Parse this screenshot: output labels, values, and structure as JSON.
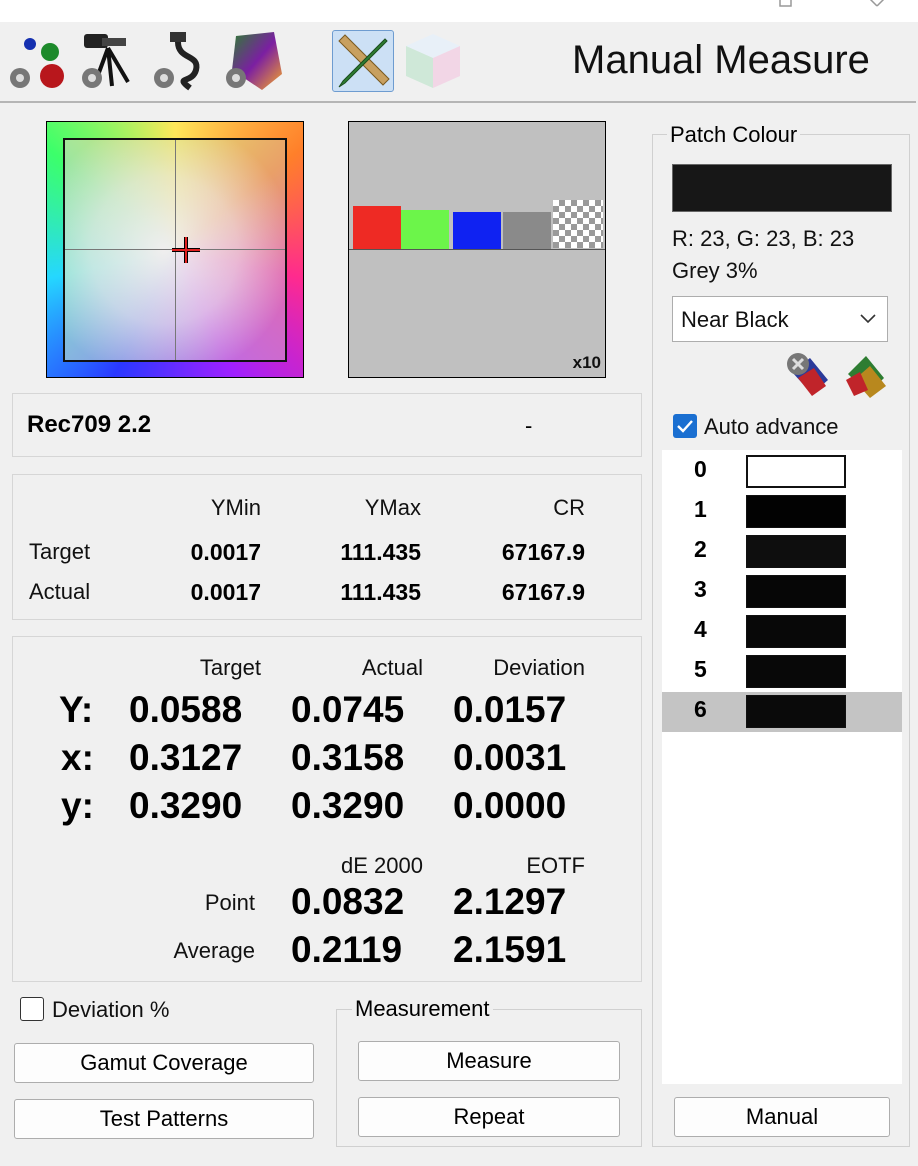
{
  "window": {
    "title": "Manual Measure"
  },
  "toolbar": {
    "icons": [
      {
        "name": "colour-dots-icon"
      },
      {
        "name": "tripod-meter-icon"
      },
      {
        "name": "cable-icon"
      },
      {
        "name": "colour-gamut-icon"
      },
      {
        "name": "pencil-ruler-icon"
      },
      {
        "name": "colour-cube-icon"
      }
    ]
  },
  "preview": {
    "zoom_label": "x10",
    "swatch_colors": [
      "#ee2a24",
      "#6cf54a",
      "#0f22f2",
      "#8a8a8a"
    ]
  },
  "profile": {
    "name": "Rec709 2.2",
    "status": "-"
  },
  "luminance": {
    "headers": [
      "YMin",
      "YMax",
      "CR"
    ],
    "rows": [
      {
        "label": "Target",
        "values": [
          "0.0017",
          "111.435",
          "67167.9"
        ]
      },
      {
        "label": "Actual",
        "values": [
          "0.0017",
          "111.435",
          "67167.9"
        ]
      }
    ]
  },
  "readings": {
    "headers": [
      "Target",
      "Actual",
      "Deviation"
    ],
    "rows": [
      {
        "label": "Y:",
        "values": [
          "0.0588",
          "0.0745",
          "0.0157"
        ]
      },
      {
        "label": "x:",
        "values": [
          "0.3127",
          "0.3158",
          "0.0031"
        ]
      },
      {
        "label": "y:",
        "values": [
          "0.3290",
          "0.3290",
          "0.0000"
        ]
      }
    ],
    "de_headers": [
      "dE 2000",
      "EOTF"
    ],
    "de_rows": [
      {
        "label": "Point",
        "values": [
          "0.0832",
          "2.1297"
        ]
      },
      {
        "label": "Average",
        "values": [
          "0.2119",
          "2.1591"
        ]
      }
    ]
  },
  "options": {
    "deviation_percent_label": "Deviation %",
    "deviation_percent_checked": false,
    "gamut_coverage_label": "Gamut Coverage",
    "test_patterns_label": "Test Patterns"
  },
  "measurement": {
    "group_title": "Measurement",
    "measure_label": "Measure",
    "repeat_label": "Repeat"
  },
  "patch": {
    "group_title": "Patch Colour",
    "color": "#171717",
    "rgb_text": "R: 23, G: 23, B: 23",
    "grey_text": "Grey 3%",
    "select_value": "Near Black",
    "auto_advance_label": "Auto advance",
    "auto_advance_checked": true,
    "manual_label": "Manual",
    "list": [
      {
        "index": "0",
        "color": "#ffffff"
      },
      {
        "index": "1",
        "color": "#020202"
      },
      {
        "index": "2",
        "color": "#0e0e0e"
      },
      {
        "index": "3",
        "color": "#060606"
      },
      {
        "index": "4",
        "color": "#080808"
      },
      {
        "index": "5",
        "color": "#080808"
      },
      {
        "index": "6",
        "color": "#0a0a0a"
      }
    ],
    "selected_index": 6
  }
}
